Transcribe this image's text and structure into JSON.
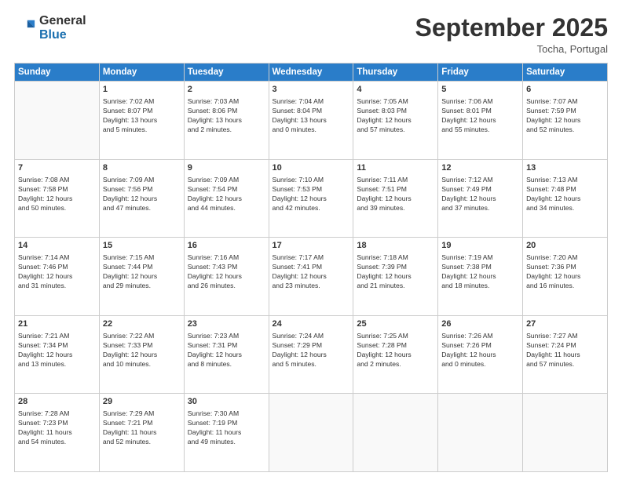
{
  "header": {
    "logo_general": "General",
    "logo_blue": "Blue",
    "month_title": "September 2025",
    "subtitle": "Tocha, Portugal"
  },
  "days_of_week": [
    "Sunday",
    "Monday",
    "Tuesday",
    "Wednesday",
    "Thursday",
    "Friday",
    "Saturday"
  ],
  "weeks": [
    [
      {
        "day": "",
        "content": ""
      },
      {
        "day": "1",
        "content": "Sunrise: 7:02 AM\nSunset: 8:07 PM\nDaylight: 13 hours\nand 5 minutes."
      },
      {
        "day": "2",
        "content": "Sunrise: 7:03 AM\nSunset: 8:06 PM\nDaylight: 13 hours\nand 2 minutes."
      },
      {
        "day": "3",
        "content": "Sunrise: 7:04 AM\nSunset: 8:04 PM\nDaylight: 13 hours\nand 0 minutes."
      },
      {
        "day": "4",
        "content": "Sunrise: 7:05 AM\nSunset: 8:03 PM\nDaylight: 12 hours\nand 57 minutes."
      },
      {
        "day": "5",
        "content": "Sunrise: 7:06 AM\nSunset: 8:01 PM\nDaylight: 12 hours\nand 55 minutes."
      },
      {
        "day": "6",
        "content": "Sunrise: 7:07 AM\nSunset: 7:59 PM\nDaylight: 12 hours\nand 52 minutes."
      }
    ],
    [
      {
        "day": "7",
        "content": "Sunrise: 7:08 AM\nSunset: 7:58 PM\nDaylight: 12 hours\nand 50 minutes."
      },
      {
        "day": "8",
        "content": "Sunrise: 7:09 AM\nSunset: 7:56 PM\nDaylight: 12 hours\nand 47 minutes."
      },
      {
        "day": "9",
        "content": "Sunrise: 7:09 AM\nSunset: 7:54 PM\nDaylight: 12 hours\nand 44 minutes."
      },
      {
        "day": "10",
        "content": "Sunrise: 7:10 AM\nSunset: 7:53 PM\nDaylight: 12 hours\nand 42 minutes."
      },
      {
        "day": "11",
        "content": "Sunrise: 7:11 AM\nSunset: 7:51 PM\nDaylight: 12 hours\nand 39 minutes."
      },
      {
        "day": "12",
        "content": "Sunrise: 7:12 AM\nSunset: 7:49 PM\nDaylight: 12 hours\nand 37 minutes."
      },
      {
        "day": "13",
        "content": "Sunrise: 7:13 AM\nSunset: 7:48 PM\nDaylight: 12 hours\nand 34 minutes."
      }
    ],
    [
      {
        "day": "14",
        "content": "Sunrise: 7:14 AM\nSunset: 7:46 PM\nDaylight: 12 hours\nand 31 minutes."
      },
      {
        "day": "15",
        "content": "Sunrise: 7:15 AM\nSunset: 7:44 PM\nDaylight: 12 hours\nand 29 minutes."
      },
      {
        "day": "16",
        "content": "Sunrise: 7:16 AM\nSunset: 7:43 PM\nDaylight: 12 hours\nand 26 minutes."
      },
      {
        "day": "17",
        "content": "Sunrise: 7:17 AM\nSunset: 7:41 PM\nDaylight: 12 hours\nand 23 minutes."
      },
      {
        "day": "18",
        "content": "Sunrise: 7:18 AM\nSunset: 7:39 PM\nDaylight: 12 hours\nand 21 minutes."
      },
      {
        "day": "19",
        "content": "Sunrise: 7:19 AM\nSunset: 7:38 PM\nDaylight: 12 hours\nand 18 minutes."
      },
      {
        "day": "20",
        "content": "Sunrise: 7:20 AM\nSunset: 7:36 PM\nDaylight: 12 hours\nand 16 minutes."
      }
    ],
    [
      {
        "day": "21",
        "content": "Sunrise: 7:21 AM\nSunset: 7:34 PM\nDaylight: 12 hours\nand 13 minutes."
      },
      {
        "day": "22",
        "content": "Sunrise: 7:22 AM\nSunset: 7:33 PM\nDaylight: 12 hours\nand 10 minutes."
      },
      {
        "day": "23",
        "content": "Sunrise: 7:23 AM\nSunset: 7:31 PM\nDaylight: 12 hours\nand 8 minutes."
      },
      {
        "day": "24",
        "content": "Sunrise: 7:24 AM\nSunset: 7:29 PM\nDaylight: 12 hours\nand 5 minutes."
      },
      {
        "day": "25",
        "content": "Sunrise: 7:25 AM\nSunset: 7:28 PM\nDaylight: 12 hours\nand 2 minutes."
      },
      {
        "day": "26",
        "content": "Sunrise: 7:26 AM\nSunset: 7:26 PM\nDaylight: 12 hours\nand 0 minutes."
      },
      {
        "day": "27",
        "content": "Sunrise: 7:27 AM\nSunset: 7:24 PM\nDaylight: 11 hours\nand 57 minutes."
      }
    ],
    [
      {
        "day": "28",
        "content": "Sunrise: 7:28 AM\nSunset: 7:23 PM\nDaylight: 11 hours\nand 54 minutes."
      },
      {
        "day": "29",
        "content": "Sunrise: 7:29 AM\nSunset: 7:21 PM\nDaylight: 11 hours\nand 52 minutes."
      },
      {
        "day": "30",
        "content": "Sunrise: 7:30 AM\nSunset: 7:19 PM\nDaylight: 11 hours\nand 49 minutes."
      },
      {
        "day": "",
        "content": ""
      },
      {
        "day": "",
        "content": ""
      },
      {
        "day": "",
        "content": ""
      },
      {
        "day": "",
        "content": ""
      }
    ]
  ]
}
